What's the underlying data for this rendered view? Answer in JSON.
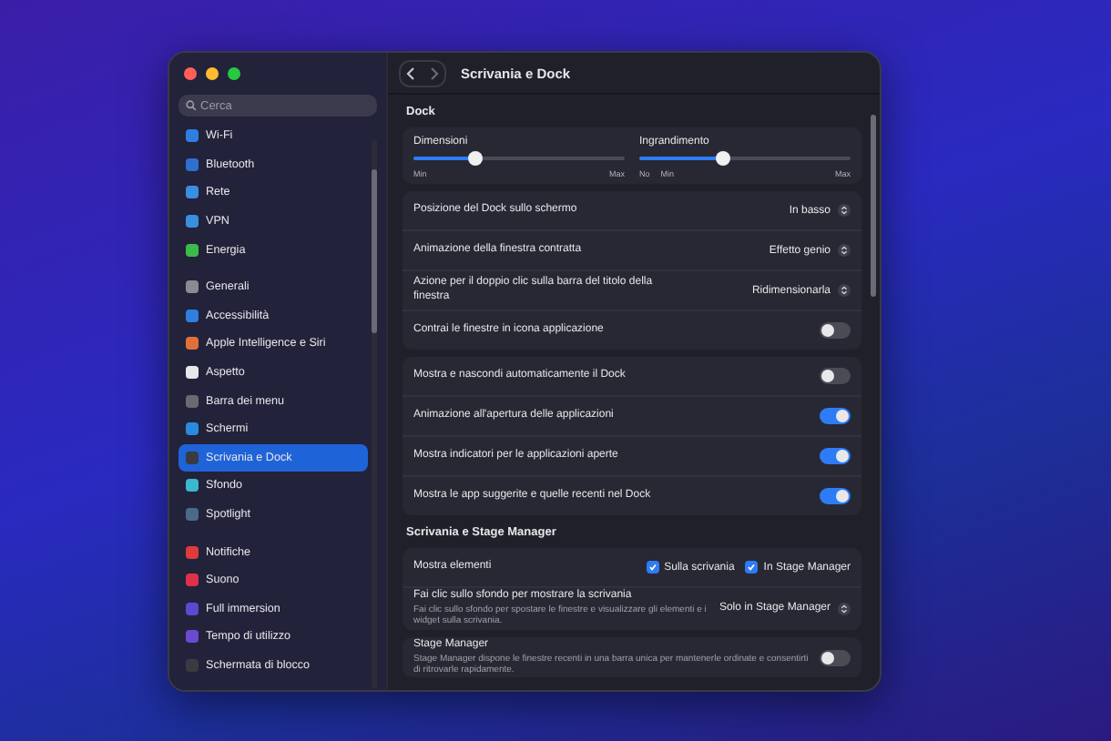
{
  "window": {
    "title": "Scrivania e Dock"
  },
  "search": {
    "placeholder": "Cerca"
  },
  "sidebar": {
    "groups": [
      [
        {
          "label": "Wi-Fi",
          "color": "#2f7fe0",
          "selected": false
        },
        {
          "label": "Bluetooth",
          "color": "#2f6fd0",
          "selected": false
        },
        {
          "label": "Rete",
          "color": "#3a8ee0",
          "selected": false
        },
        {
          "label": "VPN",
          "color": "#3a8ee0",
          "selected": false
        },
        {
          "label": "Energia",
          "color": "#3cba4a",
          "selected": false
        }
      ],
      [
        {
          "label": "Generali",
          "color": "#8a8a90",
          "selected": false
        },
        {
          "label": "Accessibilità",
          "color": "#2f7fe0",
          "selected": false
        },
        {
          "label": "Apple Intelligence e Siri",
          "color": "#e0703a",
          "selected": false
        },
        {
          "label": "Aspetto",
          "color": "#e8e8ea",
          "selected": false
        },
        {
          "label": "Barra dei menu",
          "color": "#6a6a70",
          "selected": false
        },
        {
          "label": "Schermi",
          "color": "#2a8ae0",
          "selected": false
        },
        {
          "label": "Scrivania e Dock",
          "color": "#3a3a42",
          "selected": true
        },
        {
          "label": "Sfondo",
          "color": "#3ab8d0",
          "selected": false
        },
        {
          "label": "Spotlight",
          "color": "#4a6a8a",
          "selected": false
        }
      ],
      [
        {
          "label": "Notifiche",
          "color": "#e03a3a",
          "selected": false
        },
        {
          "label": "Suono",
          "color": "#e0304a",
          "selected": false
        },
        {
          "label": "Full immersion",
          "color": "#5a4ad0",
          "selected": false
        },
        {
          "label": "Tempo di utilizzo",
          "color": "#6a4ad0",
          "selected": false
        },
        {
          "label": "Schermata di blocco",
          "color": "#3a3a42",
          "selected": false
        }
      ]
    ]
  },
  "sections": [
    {
      "heading": "Dock",
      "cards": [
        {
          "rows": [
            {
              "kind": "sliders",
              "sliders": [
                {
                  "label": "Dimensioni",
                  "level": 0.29,
                  "ticks": [
                    "Min",
                    "Max"
                  ]
                },
                {
                  "label": "Ingrandimento",
                  "level": 0.4,
                  "ticks": [
                    "No",
                    "Min",
                    "Max"
                  ]
                }
              ]
            }
          ]
        },
        {
          "rows": [
            {
              "kind": "popup",
              "label": "Posizione del Dock sullo schermo",
              "value": "In basso"
            },
            {
              "kind": "popup",
              "label": "Animazione della finestra contratta",
              "value": "Effetto genio"
            },
            {
              "kind": "popup",
              "label": "Azione per il doppio clic sulla barra del titolo della finestra",
              "value": "Ridimensionarla"
            },
            {
              "kind": "toggle",
              "label": "Contrai le finestre in icona applicazione",
              "on": false
            }
          ]
        },
        {
          "rows": [
            {
              "kind": "toggle",
              "label": "Mostra e nascondi automaticamente il Dock",
              "on": false
            },
            {
              "kind": "toggle",
              "label": "Animazione all'apertura delle applicazioni",
              "on": true
            },
            {
              "kind": "toggle",
              "label": "Mostra indicatori per le applicazioni aperte",
              "on": true
            },
            {
              "kind": "toggle",
              "label": "Mostra le app suggerite e quelle recenti nel Dock",
              "on": true
            }
          ]
        }
      ]
    },
    {
      "heading": "Scrivania e Stage Manager",
      "cards": [
        {
          "rows": [
            {
              "kind": "checks",
              "label": "Mostra elementi",
              "options": [
                {
                  "label": "Sulla scrivania",
                  "checked": true
                },
                {
                  "label": "In Stage Manager",
                  "checked": true
                }
              ]
            },
            {
              "kind": "popup",
              "label": "Fai clic sullo sfondo per mostrare la scrivania",
              "description": "Fai clic sullo sfondo per spostare le finestre e visualizzare gli elementi e i widget sulla scrivania.",
              "value": "Solo in Stage Manager"
            }
          ]
        },
        {
          "rows": [
            {
              "kind": "toggle",
              "label": "Stage Manager",
              "description": "Stage Manager dispone le finestre recenti in una barra unica per mantenerle ordinate e consentirti di ritrovarle rapidamente.",
              "on": false
            }
          ]
        }
      ]
    }
  ]
}
